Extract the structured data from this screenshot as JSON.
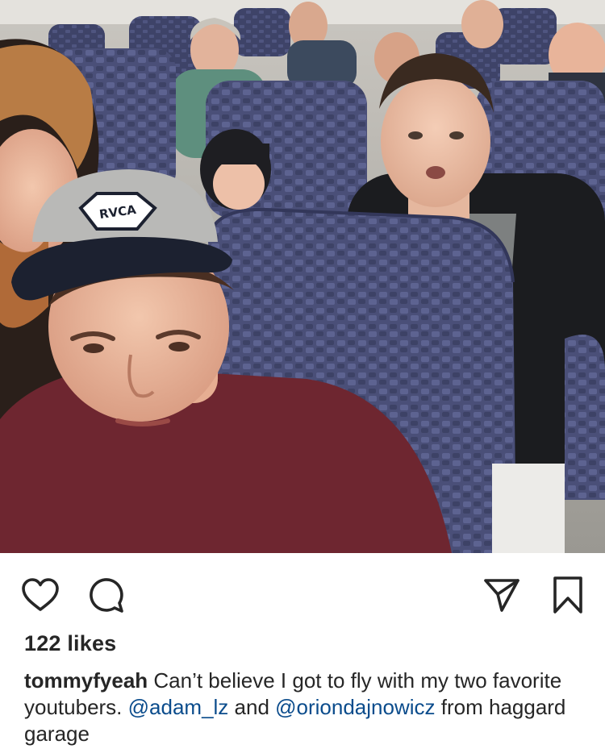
{
  "post": {
    "image": {
      "scene": "airplane-cabin-selfie",
      "cap_logo_text": "RVCA"
    },
    "actions": {
      "like_icon": "heart-icon",
      "comment_icon": "comment-bubble-icon",
      "share_icon": "paper-plane-icon",
      "save_icon": "bookmark-icon"
    },
    "likes_text": "122 likes",
    "caption": {
      "username": "tommyfyeah",
      "text_1": " Can’t believe I got to fly with my two favorite youtubers. ",
      "mention_1": "@adam_lz",
      "text_2": " and ",
      "mention_2": "@oriondajnowicz",
      "text_3": " from haggard garage"
    },
    "colors": {
      "text": "#262626",
      "mention": "#0b4c8c",
      "background": "#ffffff"
    }
  }
}
